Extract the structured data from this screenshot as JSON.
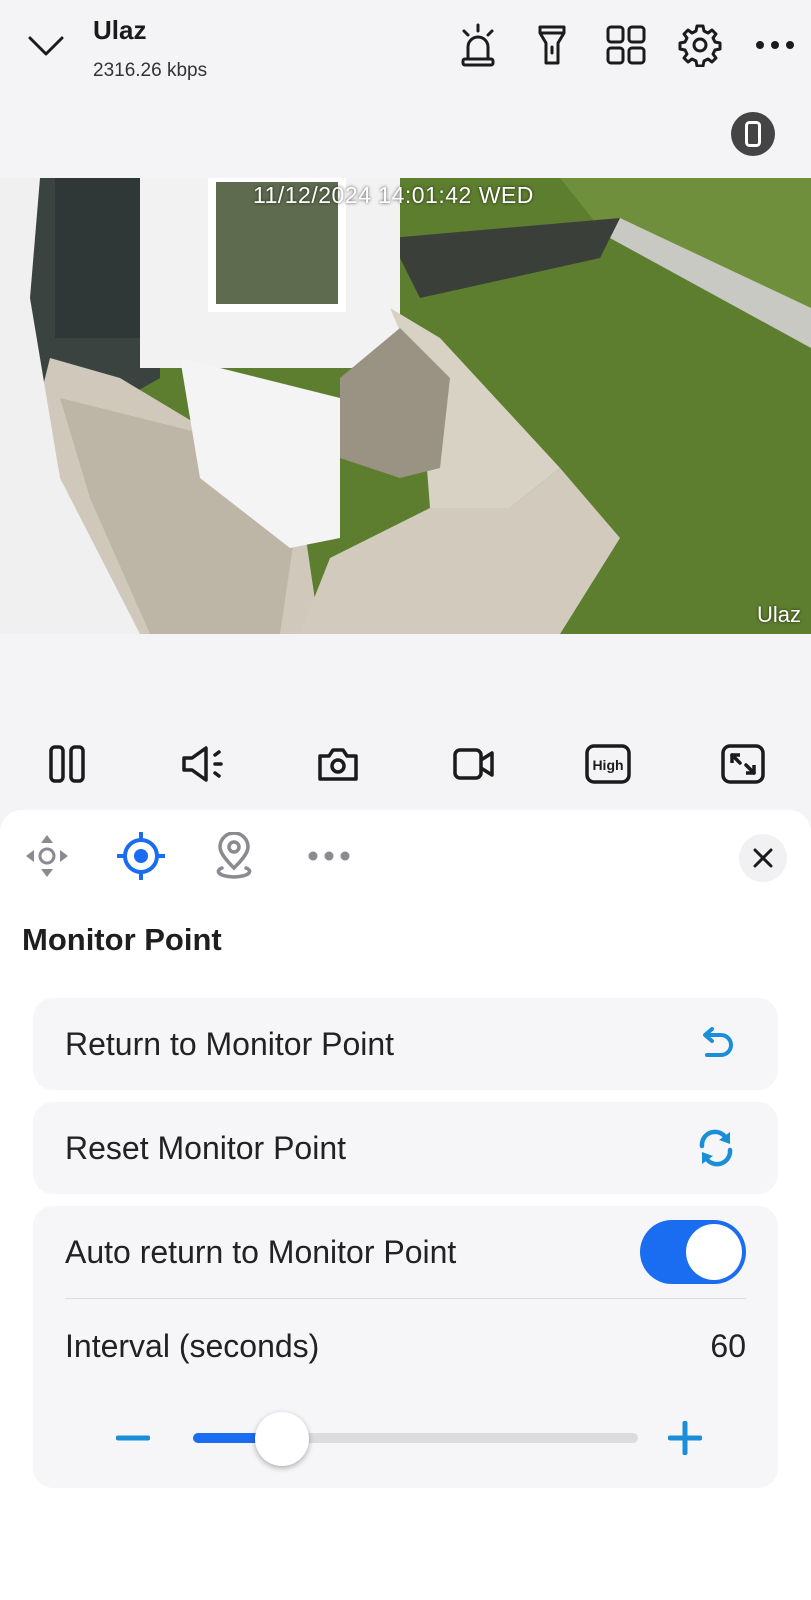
{
  "header": {
    "camera_name": "Ulaz",
    "bitrate": "2316.26 kbps",
    "icons": [
      "chevron-down-icon",
      "alarm-siren-icon",
      "flashlight-icon",
      "grid-view-icon",
      "gear-icon",
      "more-icon",
      "phone-icon"
    ]
  },
  "video": {
    "timestamp": "11/12/2024 14:01:42 WED",
    "channel_label": "Ulaz"
  },
  "controls": {
    "icons": [
      "pause-icon",
      "speaker-icon",
      "snapshot-icon",
      "record-icon",
      "quality-icon",
      "fullscreen-icon"
    ],
    "quality_label": "High"
  },
  "panel": {
    "tabs": [
      "ptz-direction-icon",
      "monitor-point-icon",
      "location-pin-icon",
      "more-icon"
    ],
    "section_title": "Monitor Point",
    "return_label": "Return to Monitor Point",
    "reset_label": "Reset Monitor Point",
    "auto_return_label": "Auto return to Monitor Point",
    "auto_return_enabled": true,
    "interval_label": "Interval (seconds)",
    "interval_value": "60",
    "slider_fraction": 0.2
  },
  "colors": {
    "accent": "#1a6cf0",
    "icon_dark": "#1b1b1b",
    "tab_gray": "#8a8a90"
  }
}
